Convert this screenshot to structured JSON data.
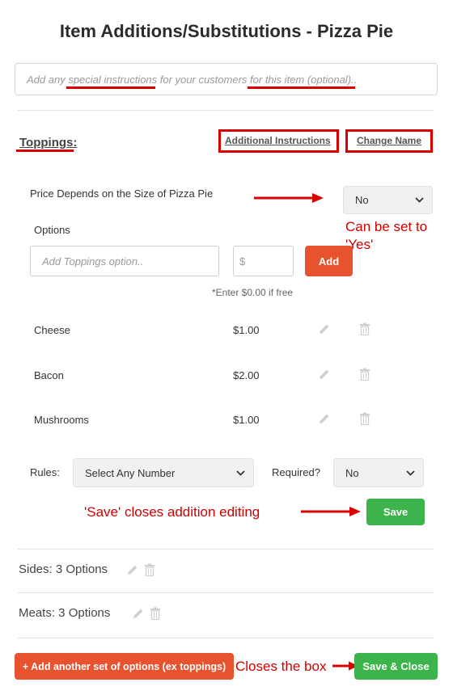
{
  "modal": {
    "title": "Item Additions/Substitutions - Pizza Pie",
    "instructions": {
      "part1": "Add any ",
      "part2": "special instructions",
      "part3": " for your customers ",
      "part4": "for this item (optional).."
    }
  },
  "toppings": {
    "section_title": "Toppings:",
    "additional_instructions_link": "Additional Instructions",
    "change_name_link": "Change Name",
    "price_label": "Price Depends on the Size of Pizza Pie",
    "price_select_value": "No",
    "options_label": "Options",
    "option_input_placeholder": "Add Toppings option..",
    "price_input_placeholder": "$",
    "add_button": "Add",
    "free_hint": "*Enter $0.00 if free",
    "items": [
      {
        "name": "Cheese",
        "price": "$1.00"
      },
      {
        "name": "Bacon",
        "price": "$2.00"
      },
      {
        "name": "Mushrooms",
        "price": "$1.00"
      }
    ],
    "rules_label": "Rules:",
    "rules_value": "Select Any Number",
    "required_label": "Required?",
    "required_value": "No",
    "save_button": "Save"
  },
  "groups": [
    {
      "label": "Sides: 3 Options"
    },
    {
      "label": "Meats: 3 Options"
    }
  ],
  "footer": {
    "add_set_button": "+ Add another set of options (ex toppings)",
    "save_close_button": "Save & Close"
  },
  "annotations": {
    "set_yes_line1": "Can be set to",
    "set_yes_line2": "'Yes'",
    "save_note": "'Save' closes addition editing",
    "closes_note": "Closes the box"
  },
  "colors": {
    "annotation_red": "#d90000",
    "orange": "#e8532f",
    "green": "#3cb44b"
  }
}
